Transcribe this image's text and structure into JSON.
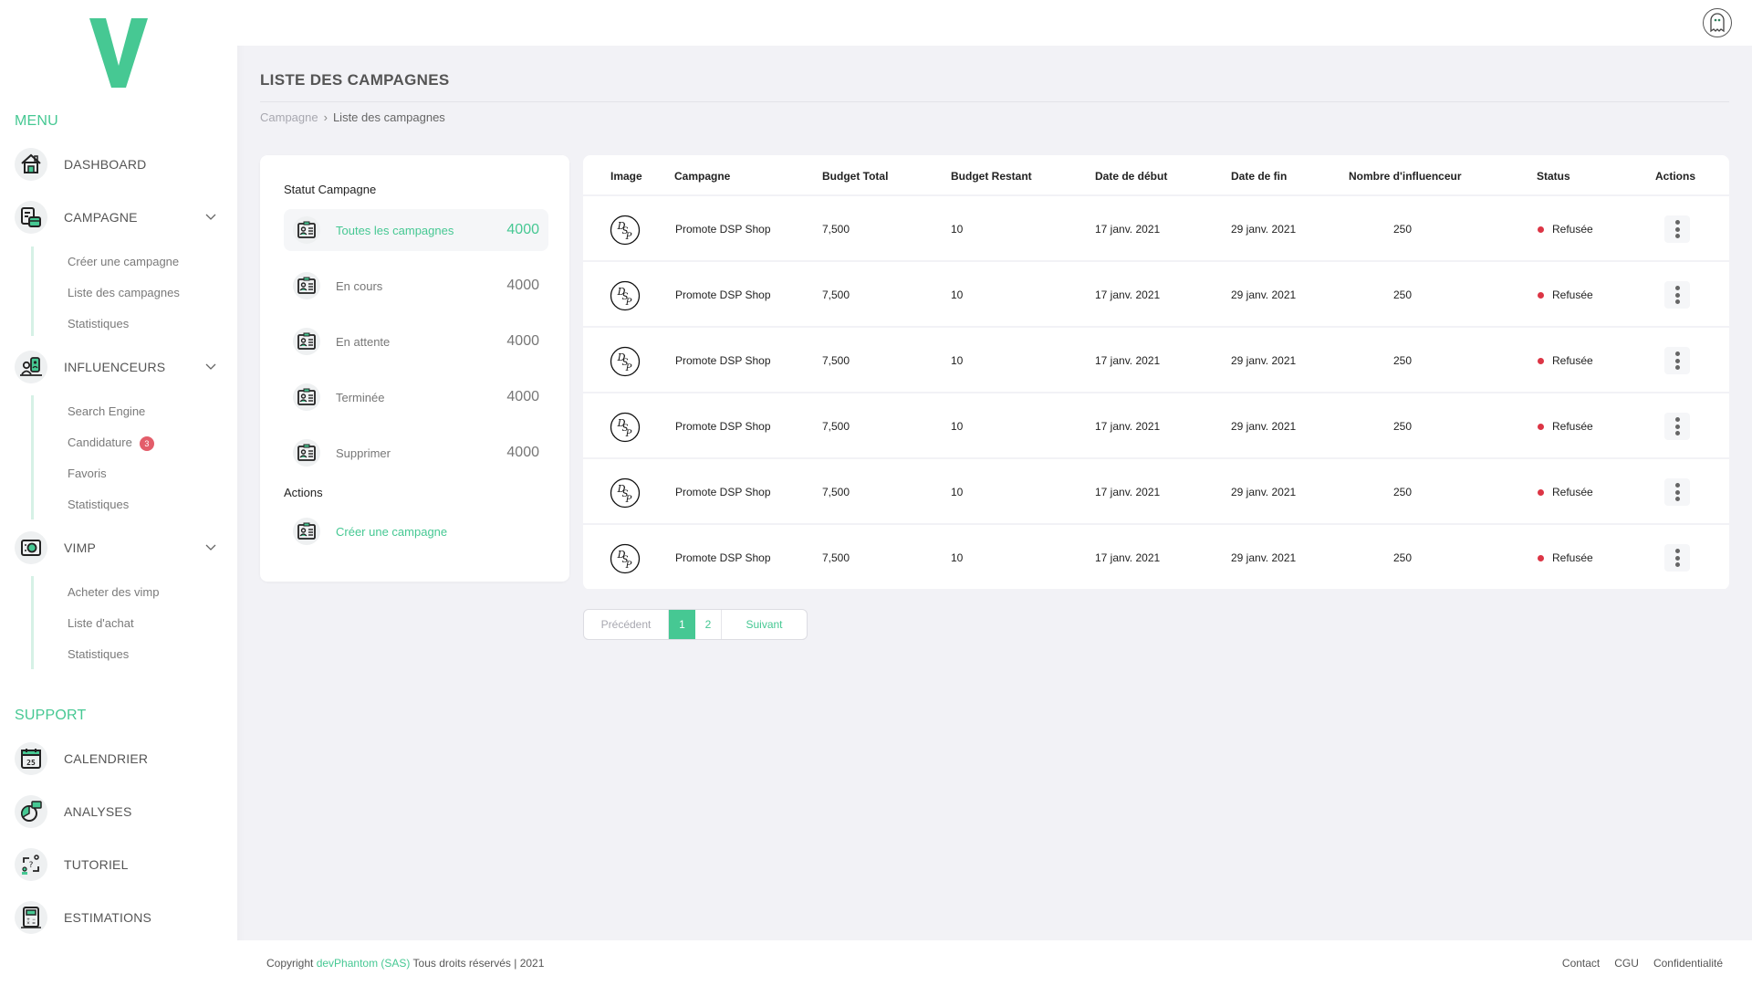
{
  "brand": {
    "logo_letter": "V",
    "accent": "#46c893"
  },
  "sidebar": {
    "menu_title": "MENU",
    "support_title": "SUPPORT",
    "items": [
      {
        "label": "DASHBOARD",
        "icon": "home-icon"
      },
      {
        "label": "CAMPAGNE",
        "icon": "campaign-icon",
        "expanded": true,
        "children": [
          {
            "label": "Créer une campagne"
          },
          {
            "label": "Liste des campagnes"
          },
          {
            "label": "Statistiques"
          }
        ]
      },
      {
        "label": "INFLUENCEURS",
        "icon": "influencer-icon",
        "expanded": true,
        "children": [
          {
            "label": "Search Engine"
          },
          {
            "label": "Candidature",
            "badge": "3"
          },
          {
            "label": "Favoris"
          },
          {
            "label": "Statistiques"
          }
        ]
      },
      {
        "label": "VIMP",
        "icon": "safe-icon",
        "expanded": true,
        "children": [
          {
            "label": "Acheter des vimp"
          },
          {
            "label": "Liste d'achat"
          },
          {
            "label": "Statistiques"
          }
        ]
      }
    ],
    "support_items": [
      {
        "label": "CALENDRIER",
        "icon": "calendar-icon",
        "calendar_day": "25"
      },
      {
        "label": "ANALYSES",
        "icon": "pie-chart-icon"
      },
      {
        "label": "TUTORIEL",
        "icon": "tutorial-icon"
      },
      {
        "label": "ESTIMATIONS",
        "icon": "calculator-icon"
      }
    ]
  },
  "header": {
    "user_icon": "ghost-avatar-icon"
  },
  "page": {
    "title": "LISTE DES CAMPAGNES",
    "breadcrumb": [
      {
        "label": "Campagne"
      },
      {
        "label": "Liste des campagnes"
      }
    ],
    "breadcrumb_sep": "›"
  },
  "filters": {
    "heading": "Statut Campagne",
    "items": [
      {
        "label": "Toutes les campagnes",
        "count": "4000",
        "active": true
      },
      {
        "label": "En cours",
        "count": "4000"
      },
      {
        "label": "En attente",
        "count": "4000"
      },
      {
        "label": "Terminée",
        "count": "4000"
      },
      {
        "label": "Supprimer",
        "count": "4000"
      }
    ],
    "actions_heading": "Actions",
    "actions": [
      {
        "label": "Créer une campagne"
      }
    ]
  },
  "table": {
    "columns": [
      "Image",
      "Campagne",
      "Budget Total",
      "Budget Restant",
      "Date de début",
      "Date de fin",
      "Nombre d'influenceur",
      "Status",
      "Actions"
    ],
    "rows": [
      {
        "image": "DSP",
        "campagne": "Promote DSP Shop",
        "budget_total": "7,500",
        "budget_restant": "10",
        "date_debut": "17 janv. 2021",
        "date_fin": "29 janv. 2021",
        "influenceurs": "250",
        "status": "Refusée"
      },
      {
        "image": "DSP",
        "campagne": "Promote DSP Shop",
        "budget_total": "7,500",
        "budget_restant": "10",
        "date_debut": "17 janv. 2021",
        "date_fin": "29 janv. 2021",
        "influenceurs": "250",
        "status": "Refusée"
      },
      {
        "image": "DSP",
        "campagne": "Promote DSP Shop",
        "budget_total": "7,500",
        "budget_restant": "10",
        "date_debut": "17 janv. 2021",
        "date_fin": "29 janv. 2021",
        "influenceurs": "250",
        "status": "Refusée"
      },
      {
        "image": "DSP",
        "campagne": "Promote DSP Shop",
        "budget_total": "7,500",
        "budget_restant": "10",
        "date_debut": "17 janv. 2021",
        "date_fin": "29 janv. 2021",
        "influenceurs": "250",
        "status": "Refusée"
      },
      {
        "image": "DSP",
        "campagne": "Promote DSP Shop",
        "budget_total": "7,500",
        "budget_restant": "10",
        "date_debut": "17 janv. 2021",
        "date_fin": "29 janv. 2021",
        "influenceurs": "250",
        "status": "Refusée"
      },
      {
        "image": "DSP",
        "campagne": "Promote DSP Shop",
        "budget_total": "7,500",
        "budget_restant": "10",
        "date_debut": "17 janv. 2021",
        "date_fin": "29 janv. 2021",
        "influenceurs": "250",
        "status": "Refusée"
      }
    ],
    "status_color": "#dc3545"
  },
  "pagination": {
    "prev": "Précédent",
    "pages": [
      "1",
      "2"
    ],
    "current": "1",
    "next": "Suivant"
  },
  "footer": {
    "copyright_prefix": "Copyright",
    "company": "devPhantom (SAS)",
    "copyright_suffix": "Tous droits réservés | 2021",
    "links": [
      "Contact",
      "CGU",
      "Confidentialité"
    ]
  }
}
